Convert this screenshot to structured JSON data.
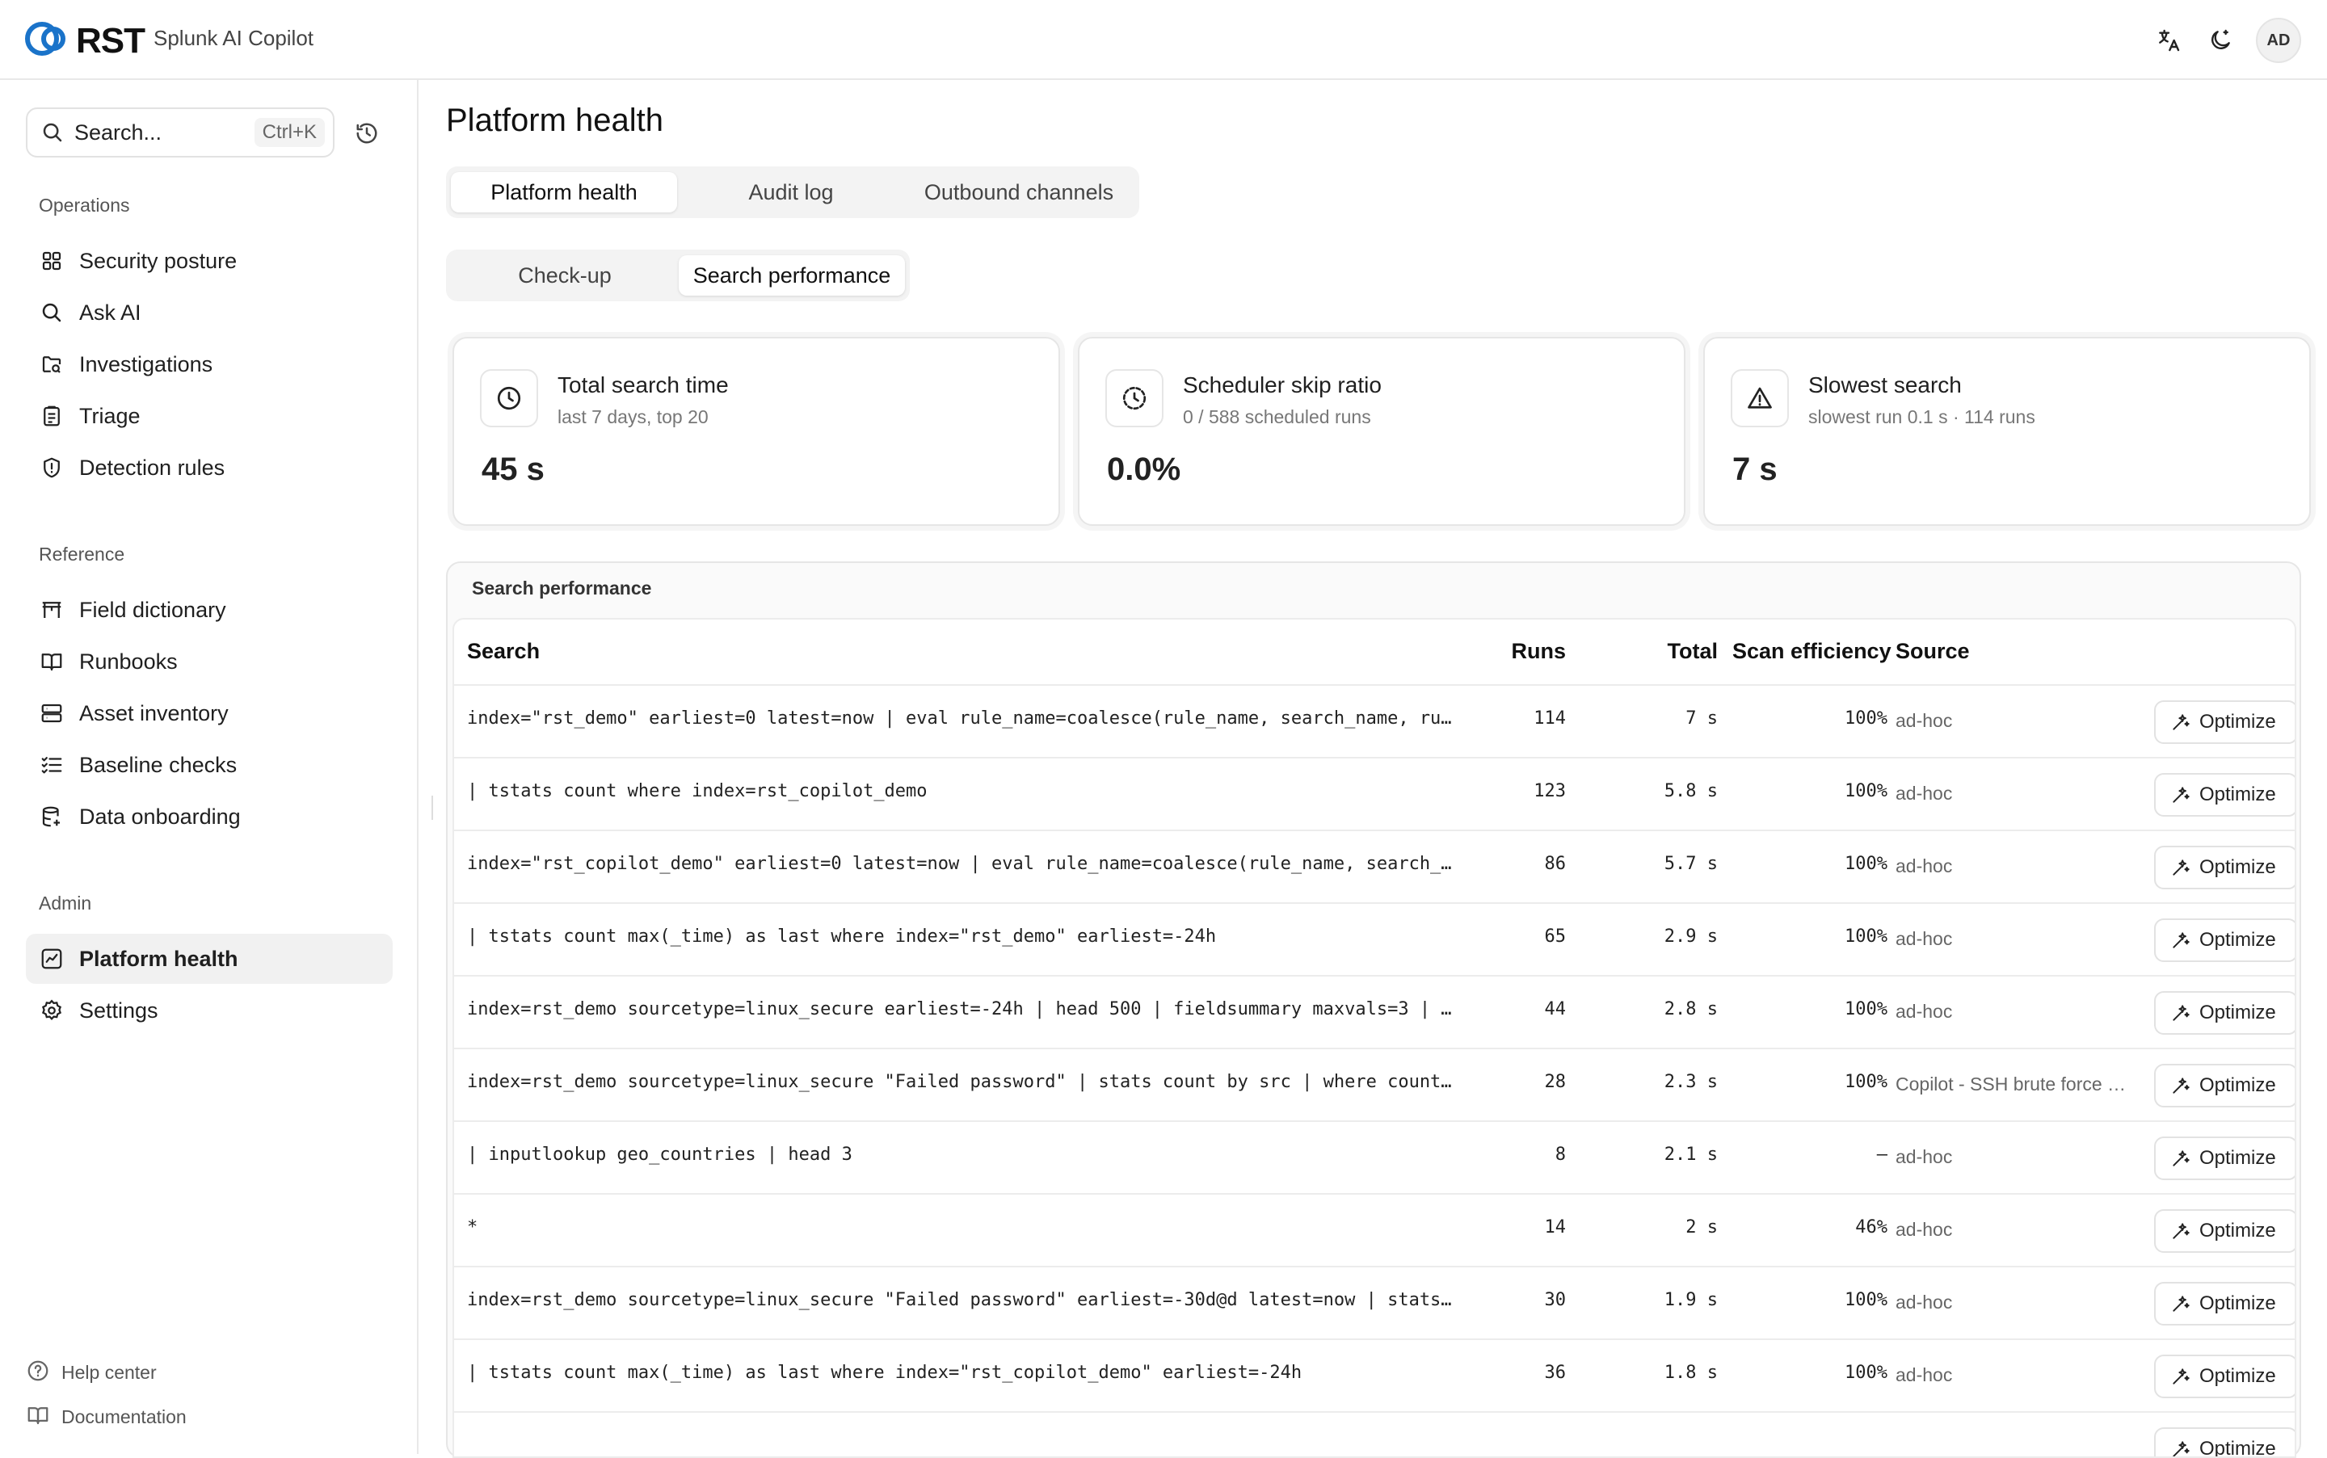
{
  "header": {
    "logo_text": "RST",
    "app_name": "Splunk AI Copilot",
    "avatar": "AD",
    "icons": [
      "translate-icon",
      "theme-toggle-icon"
    ]
  },
  "sidebar": {
    "search_placeholder": "Search...",
    "search_shortcut": "Ctrl+K",
    "sections": [
      {
        "label": "Operations",
        "items": [
          {
            "label": "Security posture",
            "icon": "grid-icon"
          },
          {
            "label": "Ask AI",
            "icon": "search-icon"
          },
          {
            "label": "Investigations",
            "icon": "folder-search-icon"
          },
          {
            "label": "Triage",
            "icon": "clipboard-icon"
          },
          {
            "label": "Detection rules",
            "icon": "shield-alert-icon"
          }
        ]
      },
      {
        "label": "Reference",
        "items": [
          {
            "label": "Field dictionary",
            "icon": "table-icon"
          },
          {
            "label": "Runbooks",
            "icon": "book-icon"
          },
          {
            "label": "Asset inventory",
            "icon": "server-icon"
          },
          {
            "label": "Baseline checks",
            "icon": "checklist-icon"
          },
          {
            "label": "Data onboarding",
            "icon": "database-icon"
          }
        ]
      },
      {
        "label": "Admin",
        "items": [
          {
            "label": "Platform health",
            "icon": "activity-icon",
            "active": true
          },
          {
            "label": "Settings",
            "icon": "gear-icon"
          }
        ]
      }
    ],
    "footer": [
      {
        "label": "Help center",
        "icon": "help-icon"
      },
      {
        "label": "Documentation",
        "icon": "book-icon"
      }
    ]
  },
  "main": {
    "title": "Platform health",
    "tabs": [
      {
        "label": "Platform health",
        "selected": true
      },
      {
        "label": "Audit log",
        "selected": false
      },
      {
        "label": "Outbound channels",
        "selected": false
      }
    ],
    "subtabs": [
      {
        "label": "Check-up",
        "selected": false
      },
      {
        "label": "Search performance",
        "selected": true
      }
    ],
    "cards": [
      {
        "title": "Total search time",
        "subtitle": "last 7 days, top 20",
        "value": "45 s",
        "icon": "clock-icon"
      },
      {
        "title": "Scheduler skip ratio",
        "subtitle": "0 / 588 scheduled runs",
        "value": "0.0%",
        "icon": "timer-icon"
      },
      {
        "title": "Slowest search",
        "subtitle": "slowest run 0.1 s · 114 runs",
        "value": "7 s",
        "icon": "warning-icon"
      }
    ],
    "panel": {
      "title": "Search performance",
      "columns": [
        "Search",
        "Runs",
        "Total",
        "Scan efficiency",
        "Source"
      ],
      "action_label": "Optimize",
      "rows": [
        {
          "search": "index=\"rst_demo\" earliest=0 latest=now | eval rule_name=coalesce(rule_name, search_name, ru…",
          "runs": "114",
          "total": "7 s",
          "efficiency": "100%",
          "source": "ad-hoc"
        },
        {
          "search": "| tstats count where index=rst_copilot_demo",
          "runs": "123",
          "total": "5.8 s",
          "efficiency": "100%",
          "source": "ad-hoc"
        },
        {
          "search": "index=\"rst_copilot_demo\" earliest=0 latest=now | eval rule_name=coalesce(rule_name, search_…",
          "runs": "86",
          "total": "5.7 s",
          "efficiency": "100%",
          "source": "ad-hoc"
        },
        {
          "search": "| tstats count max(_time) as last where index=\"rst_demo\" earliest=-24h",
          "runs": "65",
          "total": "2.9 s",
          "efficiency": "100%",
          "source": "ad-hoc"
        },
        {
          "search": "index=rst_demo sourcetype=linux_secure earliest=-24h | head 500 | fieldsummary maxvals=3 | …",
          "runs": "44",
          "total": "2.8 s",
          "efficiency": "100%",
          "source": "ad-hoc"
        },
        {
          "search": "index=rst_demo sourcetype=linux_secure \"Failed password\" | stats count by src | where count…",
          "runs": "28",
          "total": "2.3 s",
          "efficiency": "100%",
          "source": "Copilot - SSH brute force …"
        },
        {
          "search": "| inputlookup geo_countries | head 3",
          "runs": "8",
          "total": "2.1 s",
          "efficiency": "–",
          "source": "ad-hoc"
        },
        {
          "search": "*",
          "runs": "14",
          "total": "2 s",
          "efficiency": "46%",
          "source": "ad-hoc"
        },
        {
          "search": "index=rst_demo sourcetype=linux_secure \"Failed password\" earliest=-30d@d latest=now | stats…",
          "runs": "30",
          "total": "1.9 s",
          "efficiency": "100%",
          "source": "ad-hoc"
        },
        {
          "search": "| tstats count max(_time) as last where index=\"rst_copilot_demo\" earliest=-24h",
          "runs": "36",
          "total": "1.8 s",
          "efficiency": "100%",
          "source": "ad-hoc"
        },
        {
          "search": "",
          "runs": "",
          "total": "",
          "efficiency": "",
          "source": ""
        }
      ]
    }
  }
}
